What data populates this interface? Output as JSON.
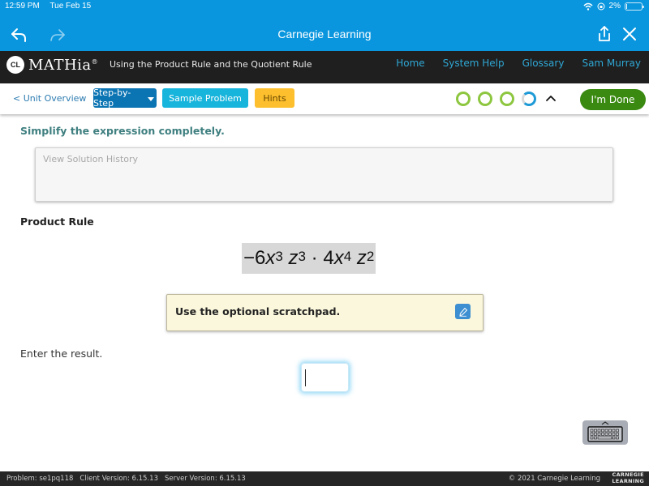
{
  "status_bar": {
    "time": "12:59 PM",
    "date": "Tue Feb 15",
    "battery": "2%",
    "battery_level": 0.02,
    "icons": [
      "wifi-icon",
      "orientation-lock-icon",
      "battery-icon"
    ]
  },
  "app_bar": {
    "title": "Carnegie Learning",
    "icons": [
      "back-arrow-icon",
      "forward-arrow-icon",
      "share-icon",
      "close-icon"
    ]
  },
  "header": {
    "logo_mark": "CL",
    "logo_text": "MATHia",
    "logo_reg": "®",
    "lesson_title": "Using the Product Rule and the Quotient Rule",
    "links": [
      "Home",
      "System Help",
      "Glossary",
      "Sam Murray"
    ],
    "link_color": "#2fa7d4"
  },
  "toolbar": {
    "unit_overview": "< Unit Overview",
    "step_by_step": "Step-by-Step",
    "sample_problem": "Sample Problem",
    "hints": "Hints",
    "done": "I'm Done",
    "progress": {
      "skills": [
        {
          "state": "complete",
          "color": "#8dc63f"
        },
        {
          "state": "complete",
          "color": "#8dc63f"
        },
        {
          "state": "complete",
          "color": "#8dc63f"
        },
        {
          "state": "in-progress",
          "fraction": 0.6,
          "color": "#1e9ad6"
        }
      ]
    },
    "colors": {
      "step_by_step": "#0b74b3",
      "sample_problem": "#17b4dc",
      "hints": "#fdbf2d",
      "done": "#3a8a12"
    }
  },
  "problem": {
    "instruction": "Simplify the expression completely.",
    "history_placeholder": "View Solution History",
    "section": "Product Rule",
    "expression": {
      "coef1": "−6",
      "v1": "x",
      "e1": "3",
      "v2": "z",
      "e2": "3",
      "dot": "·",
      "coef2": "4",
      "v3": "x",
      "e3": "4",
      "v4": "z",
      "e4": "2"
    },
    "scratchpad_text": "Use the optional scratchpad.",
    "enter_label": "Enter the result.",
    "answer_value": ""
  },
  "footer": {
    "problem": "Problem: se1pq118",
    "client_version": "Client Version: 6.15.13",
    "server_version": "Server Version: 6.15.13",
    "copyright": "© 2021 Carnegie Learning",
    "brand_line1": "CARNEGIE",
    "brand_line2": "LEARNING"
  }
}
